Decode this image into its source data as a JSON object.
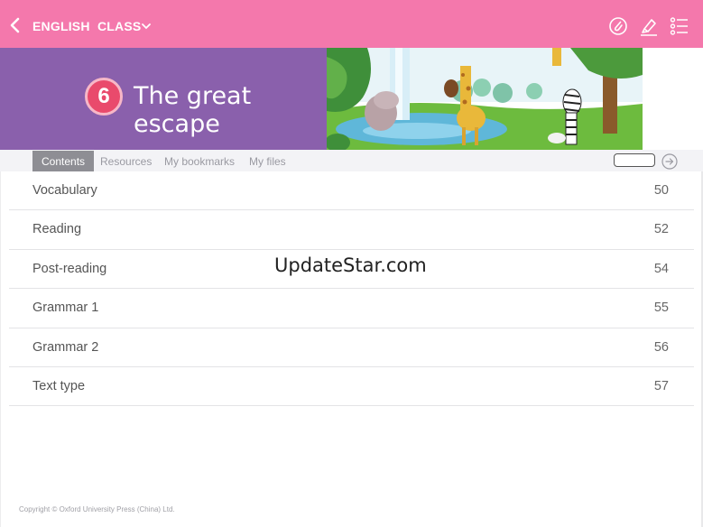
{
  "header": {
    "subject": "ENGLISH",
    "class_label": "CLASS",
    "colors": {
      "bar": "#f478ac"
    }
  },
  "banner": {
    "unit_number": "6",
    "unit_title": "The great escape",
    "colors": {
      "panel": "#8a60ac",
      "badge": "#e94a6c"
    }
  },
  "tabs": [
    {
      "label": "Contents",
      "active": true
    },
    {
      "label": "Resources",
      "active": false
    },
    {
      "label": "My bookmarks",
      "active": false
    },
    {
      "label": "My files",
      "active": false
    }
  ],
  "contents": [
    {
      "title": "Vocabulary",
      "page": "50"
    },
    {
      "title": "Reading",
      "page": "52"
    },
    {
      "title": "Post-reading",
      "page": "54"
    },
    {
      "title": "Grammar 1",
      "page": "55"
    },
    {
      "title": "Grammar 2",
      "page": "56"
    },
    {
      "title": "Text type",
      "page": "57"
    }
  ],
  "watermark": "UpdateStar.com",
  "footer": {
    "copyright": "Copyright © Oxford University Press (China) Ltd."
  },
  "icons": [
    "back-arrow-icon",
    "chevron-down-icon",
    "clip-icon",
    "highlighter-icon",
    "list-menu-icon",
    "arrow-right-circle-icon"
  ]
}
